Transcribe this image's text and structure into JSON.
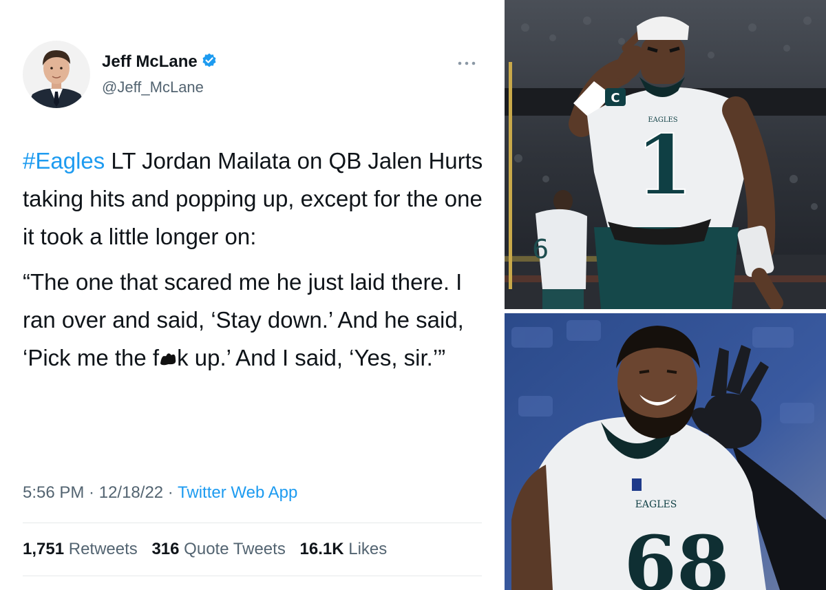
{
  "tweet": {
    "author": {
      "display_name": "Jeff McLane",
      "handle": "@Jeff_McLane",
      "avatar": "person-portrait",
      "verified": true
    },
    "more_icon": "more-horizontal-icon",
    "body": {
      "hashtag": "#Eagles",
      "text": " LT Jordan Mailata on QB Jalen Hurts taking hits and popping up, except for the one it took a little longer on:",
      "quote_part1": "“The one that scared me he just laid there. I ran over and said, ‘Stay down.’ And he said, ‘Pick me the f",
      "quote_part2": "k up.’ And I said, ‘Yes, sir.’”"
    },
    "meta": {
      "time": "5:56 PM",
      "separator": " · ",
      "date": "12/18/22",
      "source": "Twitter Web App"
    },
    "stats": {
      "retweets_count": "1,751",
      "retweets_label": "Retweets",
      "quotes_count": "316",
      "quotes_label": "Quote Tweets",
      "likes_count": "16.1K",
      "likes_label": "Likes"
    }
  },
  "photos": {
    "top": {
      "subject": "quarterback-photo",
      "jersey_number": "1",
      "captain_patch": "C",
      "wordmark": "EAGLES",
      "background_jersey_number": "6"
    },
    "bottom": {
      "subject": "lineman-photo",
      "jersey_number": "68",
      "wordmark": "EAGLES"
    }
  },
  "colors": {
    "link": "#1d9bf0",
    "text": "#0f1419",
    "secondary": "#536471",
    "verified": "#1d9bf0",
    "eagles_green": "#004c54"
  }
}
